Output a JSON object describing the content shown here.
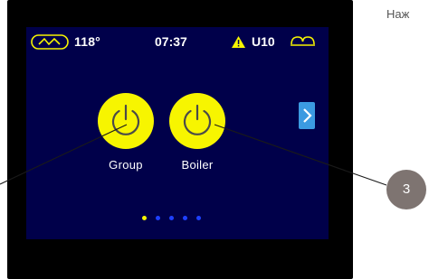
{
  "status": {
    "temperature": "118°",
    "time": "07:37",
    "alert_code": "U10"
  },
  "icons": {
    "boiler": "boiler-temperature-icon",
    "warning": "warning-triangle-icon",
    "unit": "unit-status-icon",
    "power": "power-icon",
    "next": "chevron-right-icon"
  },
  "tiles": [
    {
      "label": "Group"
    },
    {
      "label": "Boiler"
    }
  ],
  "pagination": {
    "total": 5,
    "active": 1
  },
  "callout": {
    "number": "3"
  },
  "header_text": "Наж",
  "colors": {
    "screen_bg": "#00004a",
    "accent_yellow": "#f7f500",
    "nav_blue": "#3b9ae1",
    "dot_blue": "#1e40ff",
    "callout_gray": "#7e7471"
  }
}
